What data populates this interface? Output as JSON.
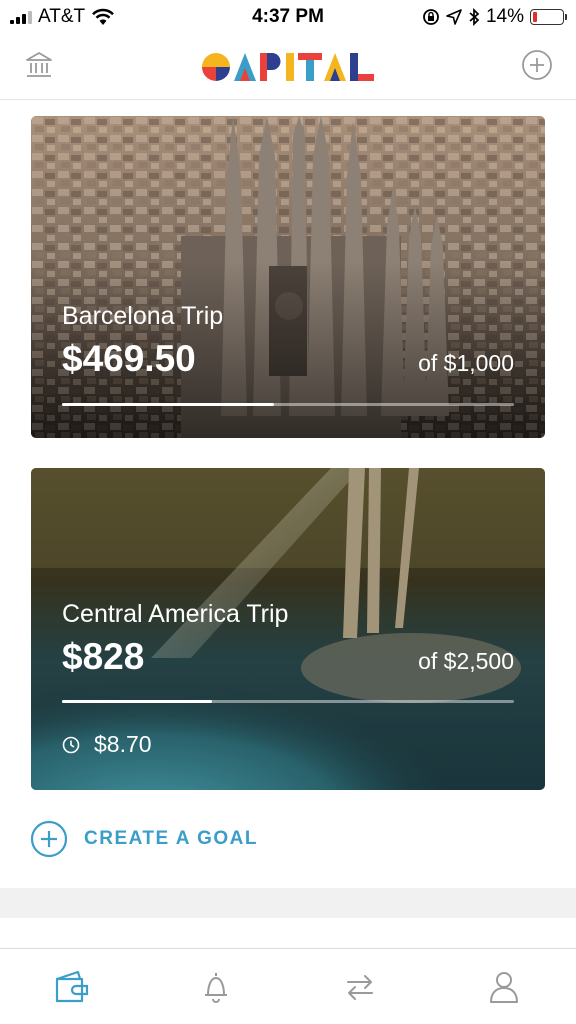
{
  "status_bar": {
    "carrier": "AT&T",
    "time": "4:37 PM",
    "battery": "14%",
    "battery_level": 0.14,
    "icons": [
      "signal-icon",
      "wifi-icon",
      "lock-rotation-icon",
      "location-icon",
      "bluetooth-icon",
      "battery-icon"
    ]
  },
  "header": {
    "logo_text": "QAPITAL",
    "left_icon": "bank-icon",
    "right_icon": "add-circle-icon"
  },
  "goals": [
    {
      "name": "Barcelona Trip",
      "saved": "$469.50",
      "target": "of $1,000",
      "progress": 0.4695,
      "image": "sagrada-familia-photo"
    },
    {
      "name": "Central America Trip",
      "saved": "$828",
      "target": "of $2,500",
      "progress": 0.3312,
      "pending_amount": "$8.70",
      "pending_icon": "clock-icon",
      "image": "cenote-photo"
    }
  ],
  "create_goal": {
    "label": "CREATE A GOAL",
    "icon": "add-circle-icon"
  },
  "tab_bar": {
    "active_index": 0,
    "active_color": "#3a9ec8",
    "inactive_color": "#9a9a9a",
    "tabs": [
      {
        "icon": "wallet-icon"
      },
      {
        "icon": "bell-icon"
      },
      {
        "icon": "transfer-arrows-icon"
      },
      {
        "icon": "profile-icon"
      }
    ]
  },
  "colors": {
    "accent": "#3a9ec8",
    "logo": [
      "#e8423a",
      "#f5b51f",
      "#2e3f8f",
      "#3a9ec8"
    ]
  }
}
